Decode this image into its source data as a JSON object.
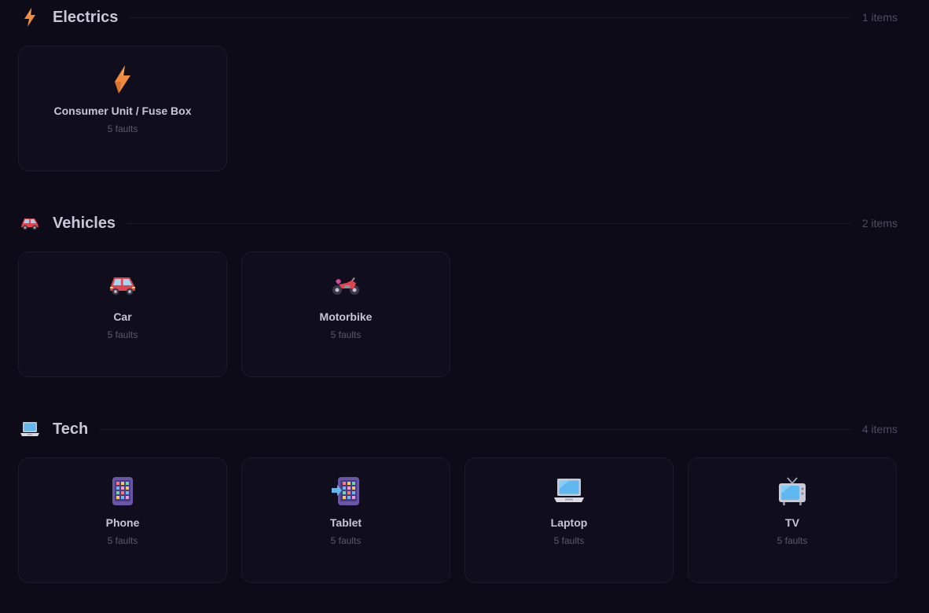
{
  "sections": [
    {
      "title": "Electrics",
      "count": "1 items",
      "icon": "lightning-icon",
      "items": [
        {
          "title": "Consumer Unit / Fuse Box",
          "sub": "5 faults",
          "icon": "lightning-icon"
        }
      ]
    },
    {
      "title": "Vehicles",
      "count": "2 items",
      "icon": "car-icon",
      "items": [
        {
          "title": "Car",
          "sub": "5 faults",
          "icon": "car-icon"
        },
        {
          "title": "Motorbike",
          "sub": "5 faults",
          "icon": "motorbike-icon"
        }
      ]
    },
    {
      "title": "Tech",
      "count": "4 items",
      "icon": "laptop-icon",
      "items": [
        {
          "title": "Phone",
          "sub": "5 faults",
          "icon": "phone-icon"
        },
        {
          "title": "Tablet",
          "sub": "5 faults",
          "icon": "tablet-icon"
        },
        {
          "title": "Laptop",
          "sub": "5 faults",
          "icon": "laptop-icon"
        },
        {
          "title": "TV",
          "sub": "5 faults",
          "icon": "tv-icon"
        }
      ]
    }
  ],
  "colors": {
    "background": "#0d0b17",
    "card": "#100e1c",
    "card_border": "#1d1b2c",
    "lightning": "#f08a3c",
    "vehicle_red": "#e0454f"
  }
}
